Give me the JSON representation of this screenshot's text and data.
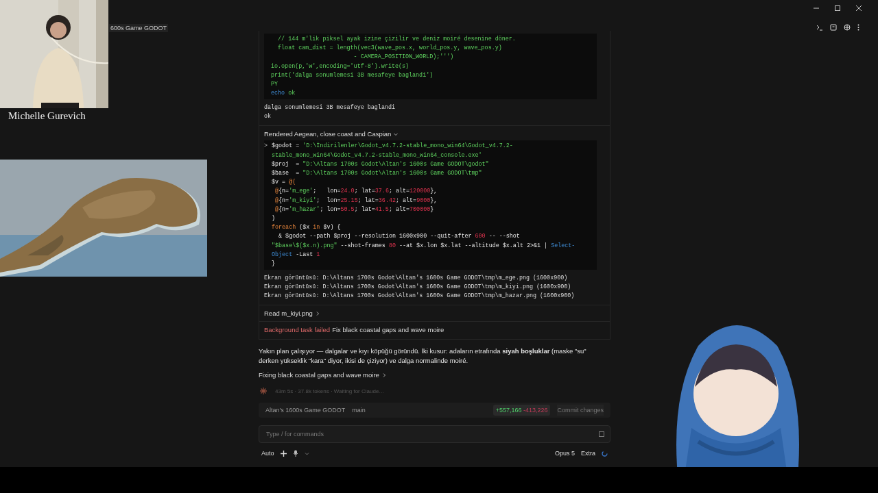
{
  "window": {
    "title": "600s Game GODOT"
  },
  "webcam": {
    "caption": "Michelle Gurevich"
  },
  "transcript": [
    {
      "kind": "code",
      "lines": [
        [
          {
            "t": "  // 144 m'lik piksel ayak izine çizilir ve deniz moiré desenine döner.",
            "kind": "str"
          }
        ],
        [
          {
            "t": "  float cam_dist = length(vec3(wave_pos.x, world_pos.y, wave_pos.y)",
            "kind": "str"
          }
        ],
        [
          {
            "t": "                        - CAMERA_POSITION_WORLD);''')",
            "kind": "str"
          }
        ],
        [
          {
            "t": "io.open(p,'w',encoding='utf-8').write(s)",
            "kind": "str"
          }
        ],
        [
          {
            "t": "print('dalga sonumlemesi 3B mesafeye baglandi')",
            "kind": "str"
          }
        ],
        [
          {
            "t": "PY",
            "kind": "str"
          }
        ],
        [
          {
            "t": "echo",
            "kind": "fn"
          },
          {
            "t": " ok",
            "kind": "str"
          }
        ]
      ]
    },
    {
      "kind": "output",
      "lines": [
        "dalga sonumlemesi 3B mesafeye baglandi",
        "ok"
      ]
    },
    {
      "kind": "tool",
      "label": "Rendered Aegean, close coast and Caspian",
      "expanded": true
    },
    {
      "kind": "code",
      "prompt": ">",
      "lines": [
        [
          {
            "t": "$godot = ",
            "kind": "plain"
          },
          {
            "t": "'D:\\İndirilenler\\Godot_v4.7.2-stable_mono_win64\\Godot_v4.7.2-",
            "kind": "str"
          }
        ],
        [
          {
            "t": "stable_mono_win64\\Godot_v4.7.2-stable_mono_win64_console.exe'",
            "kind": "str"
          }
        ],
        [
          {
            "t": "$proj  = ",
            "kind": "plain"
          },
          {
            "t": "\"D:\\Altans 1700s Godot\\Altan's 1600s Game GODOT\\godot\"",
            "kind": "str"
          }
        ],
        [
          {
            "t": "$base  = ",
            "kind": "plain"
          },
          {
            "t": "\"D:\\Altans 1700s Godot\\Altan's 1600s Game GODOT\\tmp\"",
            "kind": "str"
          }
        ],
        [
          {
            "t": "$v = ",
            "kind": "plain"
          },
          {
            "t": "@(",
            "kind": "kw"
          }
        ],
        [
          {
            "t": " @",
            "kind": "kw"
          },
          {
            "t": "{n=",
            "kind": "plain"
          },
          {
            "t": "'m_ege'",
            "kind": "str"
          },
          {
            "t": ";   lon=",
            "kind": "plain"
          },
          {
            "t": "24.0",
            "kind": "num"
          },
          {
            "t": "; lat=",
            "kind": "plain"
          },
          {
            "t": "37.6",
            "kind": "num"
          },
          {
            "t": "; alt=",
            "kind": "plain"
          },
          {
            "t": "120000",
            "kind": "num"
          },
          {
            "t": "},",
            "kind": "plain"
          }
        ],
        [
          {
            "t": " @",
            "kind": "kw"
          },
          {
            "t": "{n=",
            "kind": "plain"
          },
          {
            "t": "'m_kiyi'",
            "kind": "str"
          },
          {
            "t": ";  lon=",
            "kind": "plain"
          },
          {
            "t": "25.15",
            "kind": "num"
          },
          {
            "t": "; lat=",
            "kind": "plain"
          },
          {
            "t": "36.42",
            "kind": "num"
          },
          {
            "t": "; alt=",
            "kind": "plain"
          },
          {
            "t": "9000",
            "kind": "num"
          },
          {
            "t": "},",
            "kind": "plain"
          }
        ],
        [
          {
            "t": " @",
            "kind": "kw"
          },
          {
            "t": "{n=",
            "kind": "plain"
          },
          {
            "t": "'m_hazar'",
            "kind": "str"
          },
          {
            "t": "; lon=",
            "kind": "plain"
          },
          {
            "t": "50.5",
            "kind": "num"
          },
          {
            "t": "; lat=",
            "kind": "plain"
          },
          {
            "t": "41.5",
            "kind": "num"
          },
          {
            "t": "; alt=",
            "kind": "plain"
          },
          {
            "t": "700000",
            "kind": "num"
          },
          {
            "t": "}",
            "kind": "plain"
          }
        ],
        [
          {
            "t": ")",
            "kind": "plain"
          }
        ],
        [
          {
            "t": "foreach",
            "kind": "kw"
          },
          {
            "t": " ($x ",
            "kind": "plain"
          },
          {
            "t": "in",
            "kind": "kw"
          },
          {
            "t": " $v) {",
            "kind": "plain"
          }
        ],
        [
          {
            "t": "  & $godot --path $proj --resolution 1600x900 --quit-after ",
            "kind": "plain"
          },
          {
            "t": "600",
            "kind": "num"
          },
          {
            "t": " -- --shot",
            "kind": "plain"
          }
        ],
        [
          {
            "t": "\"$base\\$($x.n).png\"",
            "kind": "str"
          },
          {
            "t": " --shot-frames ",
            "kind": "plain"
          },
          {
            "t": "80",
            "kind": "num"
          },
          {
            "t": " --at $x.lon $x.lat --altitude $x.alt 2>&1 | ",
            "kind": "plain"
          },
          {
            "t": "Select-",
            "kind": "fn"
          }
        ],
        [
          {
            "t": "Object",
            "kind": "fn"
          },
          {
            "t": " -Last ",
            "kind": "plain"
          },
          {
            "t": "1",
            "kind": "num"
          }
        ],
        [
          {
            "t": "}",
            "kind": "plain"
          }
        ]
      ]
    },
    {
      "kind": "output",
      "lines": [
        "Ekran görüntüsü: D:\\Altans 1700s Godot\\Altan's 1600s Game GODOT\\tmp\\m_ege.png (1600x900)",
        "Ekran görüntüsü: D:\\Altans 1700s Godot\\Altan's 1600s Game GODOT\\tmp\\m_kiyi.png (1600x900)",
        "Ekran görüntüsü: D:\\Altans 1700s Godot\\Altan's 1600s Game GODOT\\tmp\\m_hazar.png (1600x900)"
      ]
    },
    {
      "kind": "tool",
      "label": "Read m_kiyi.png",
      "expanded": false
    },
    {
      "kind": "failed",
      "badge": "Background task failed",
      "text": "Fix black coastal gaps and wave moire"
    }
  ],
  "message": "Yakın plan çalışıyor — dalgalar ve kıyı köpüğü göründü. İki kusur: adaların etrafında **siyah boşluklar** (maske \"su\" derken yükseklik \"kara\" diyor, ikisi de çiziyor) ve dalga normalinde moiré.",
  "step": "Fixing black coastal gaps and wave moire",
  "status": "43m 5s · 37.8k tokens · Waiting for Claude…",
  "branch_bar": {
    "project": "Altan's 1600s Game GODOT",
    "branch": "main",
    "added": "+557,166",
    "removed": "-413,226",
    "commit": "Commit changes"
  },
  "composer": {
    "placeholder": "Type / for commands",
    "mode": "Auto",
    "model": "Opus 5",
    "effort": "Extra"
  }
}
